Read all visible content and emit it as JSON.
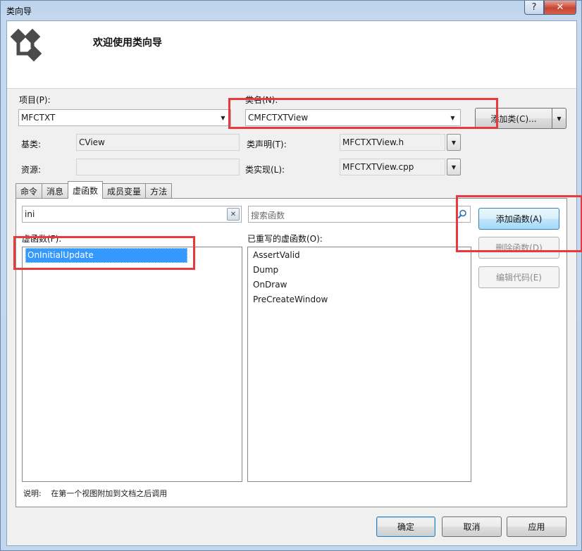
{
  "window": {
    "title": "类向导",
    "help_button": "?",
    "close_button": "✕"
  },
  "header": {
    "welcome": "欢迎使用类向导"
  },
  "project": {
    "label": "项目(P):",
    "value": "MFCTXT"
  },
  "class_name": {
    "label": "类名(N):",
    "value": "CMFCTXTView"
  },
  "add_class_button": "添加类(C)...",
  "base_class": {
    "label": "基类:",
    "value": "CView"
  },
  "resource": {
    "label": "资源:",
    "value": ""
  },
  "class_declaration": {
    "label": "类声明(T):",
    "value": "MFCTXTView.h"
  },
  "class_implementation": {
    "label": "类实现(L):",
    "value": "MFCTXTView.cpp"
  },
  "tabs": [
    {
      "label": "命令",
      "active": false
    },
    {
      "label": "消息",
      "active": false
    },
    {
      "label": "虚函数",
      "active": true
    },
    {
      "label": "成员变量",
      "active": false
    },
    {
      "label": "方法",
      "active": false
    }
  ],
  "filter": {
    "value": "ini"
  },
  "search_functions": {
    "placeholder": "搜索函数"
  },
  "virtual_functions": {
    "label": "虚函数(F):",
    "items": [
      "OnInitialUpdate"
    ],
    "selected": "OnInitialUpdate"
  },
  "overridden_functions": {
    "label": "已重写的虚函数(O):",
    "items": [
      "AssertValid",
      "Dump",
      "OnDraw",
      "PreCreateWindow"
    ]
  },
  "side_buttons": {
    "add_function": "添加函数(A)",
    "delete_function": "删除函数(D)",
    "edit_code": "编辑代码(E)"
  },
  "description": {
    "label": "说明:",
    "text": "在第一个视图附加到文档之后调用"
  },
  "footer_buttons": {
    "ok": "确定",
    "cancel": "取消",
    "apply": "应用"
  },
  "colors": {
    "highlight": "#e8393c",
    "selection": "#3399ff"
  }
}
